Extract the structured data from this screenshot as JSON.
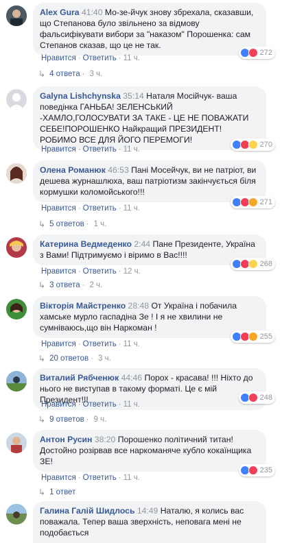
{
  "comments": [
    {
      "author": "Alex Gura",
      "timestamp": "41:40",
      "text": "Мо-зе-йчук знову збрехала, сказавши, що Степанова було звільнено за відмову фальсифікувати вибори за \"наказом\" Порошенка: сам Степанов сказав, що це не так.",
      "like_label": "Нравится",
      "reply_label": "Ответить",
      "time": "11 ч.",
      "reactions": [
        "like",
        "love"
      ],
      "reaction_count": "272",
      "replies_label": "4 ответа",
      "replies_time": "3 ч."
    },
    {
      "author": "Galyna Lishchynska",
      "timestamp": "35:14",
      "text": "Наталя Мосійчук- ваша поведінка ГАНЬБА! ЗЕЛЕНСЬКИЙ -ХАМЛО,ГОЛОСУВАТИ ЗА ТАКЕ - ЦЕ НЕ ПОВАЖАТИ СЕБЕ!ПОРОШЕНКО Найкращий ПРЕЗИДЕНТ! РОБИМО ВСЕ ДЛЯ ЙОГО ПЕРЕМОГИ!",
      "like_label": "Нравится",
      "reply_label": "Ответить",
      "time": "11 ч.",
      "reactions": [
        "like",
        "love",
        "haha"
      ],
      "reaction_count": "270",
      "replies_label": "",
      "replies_time": ""
    },
    {
      "author": "Олена Романюк",
      "timestamp": "46:53",
      "text": "Пані Мосейчук, ви не патріот, ви дешева журнашлюха, ваш патріотизм закінчується біля кормушки коломойського!!!",
      "like_label": "Нравится",
      "reply_label": "Ответить",
      "time": "11 ч.",
      "reactions": [
        "like",
        "love",
        "angry"
      ],
      "reaction_count": "271",
      "replies_label": "5 ответов",
      "replies_time": "1 ч."
    },
    {
      "author": "Катерина Ведмеденко",
      "timestamp": "2:44",
      "text": "Пане Президенте, Україна з Вами! Підтримуємо і віримо в Вас!!!!",
      "like_label": "Нравится",
      "reply_label": "Ответить",
      "time": "12 ч.",
      "reactions": [
        "like",
        "love",
        "sad"
      ],
      "reaction_count": "268",
      "replies_label": "3 ответа",
      "replies_time": "2 ч."
    },
    {
      "author": "Вікторія Майстренко",
      "timestamp": "28:48",
      "text": "От Україна і побачила хамське мурло гаспадіна Зе ! І я не хвилини не сумніваюсь,що він Наркоман !",
      "like_label": "Нравится",
      "reply_label": "Ответить",
      "time": "11 ч.",
      "reactions": [
        "like",
        "love",
        "angry"
      ],
      "reaction_count": "255",
      "replies_label": "20 ответов",
      "replies_time": "3 ч."
    },
    {
      "author": "Виталий Рябченюк",
      "timestamp": "44:46",
      "text": "Порох - красава! !!! Ніхто до нього не виступав в такому форматі. Це є мій Президент!!!",
      "like_label": "Нравится",
      "reply_label": "Ответить",
      "time": "11 ч.",
      "reactions": [
        "like",
        "love"
      ],
      "reaction_count": "248",
      "replies_label": "9 ответов",
      "replies_time": "9 ч."
    },
    {
      "author": "Антон Русин",
      "timestamp": "38:20",
      "text": "Порошенко політичний титан! Достойно розірвав все наркоманяче кубло кокаїнщика ЗЕ!",
      "like_label": "Нравится",
      "reply_label": "Ответить",
      "time": "11 ч.",
      "reactions": [
        "like",
        "love"
      ],
      "reaction_count": "235",
      "replies_label": "1 ответ",
      "replies_time": ""
    },
    {
      "author": "Галина Галій Шидлось",
      "timestamp": "14:49",
      "text": "Наталю, я колись вас поважала. Тепер ваша зверхність, неповага мені не подобається",
      "like_label": "",
      "reply_label": "",
      "time": "",
      "reactions": [],
      "reaction_count": "",
      "replies_label": "",
      "replies_time": ""
    }
  ]
}
